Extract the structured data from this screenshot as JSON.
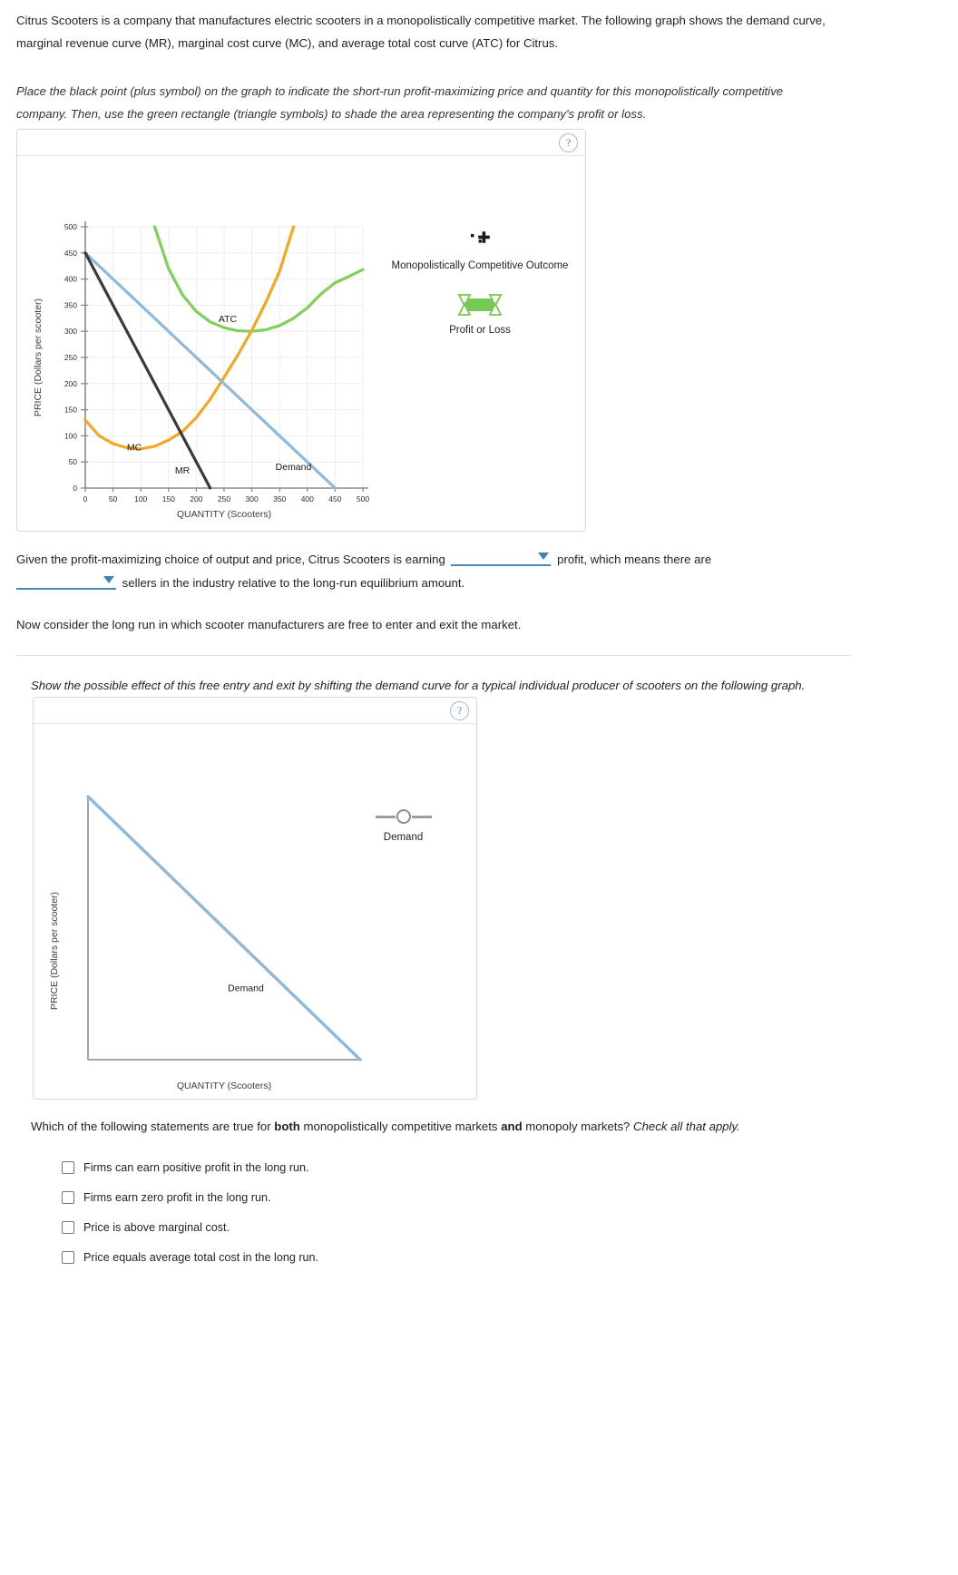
{
  "intro": {
    "paragraph": "Citrus Scooters is a company that manufactures electric scooters in a monopolistically competitive market. The following graph shows the demand curve, marginal revenue curve (MR), marginal cost curve (MC), and average total cost curve (ATC) for Citrus."
  },
  "instruction": {
    "text": "Place the black point (plus symbol) on the graph to indicate the short-run profit-maximizing price and quantity for this monopolistically competitive company. Then, use the green rectangle (triangle symbols) to shade the area representing the company's profit or loss."
  },
  "panel_one": {
    "help_label": "?",
    "tools": [
      {
        "label": "Monopolistically Competitive Outcome",
        "glyph": "black-plus-point"
      },
      {
        "label": "Profit or Loss",
        "glyph": "green-rectangle"
      }
    ]
  },
  "dropdown_sentence": {
    "part1": "Given the profit-maximizing choice of output and price, Citrus Scooters is earning",
    "part2": "profit, which means there are",
    "part3": "sellers in the industry relative to the long-run equilibrium amount.",
    "select1_value": "",
    "select2_value": ""
  },
  "long_run_text": "Now consider the long run in which scooter manufacturers are free to enter and exit the market.",
  "show_effect_text": "Show the possible effect of this free entry and exit by shifting the demand curve for a typical individual producer of scooters on the following graph.",
  "panel_two": {
    "help_label": "?",
    "tools": [
      {
        "label": "Demand",
        "glyph": "slider"
      }
    ]
  },
  "final_question": {
    "lead": "Which of the following statements are true for ",
    "bold1": "both",
    "mid": " monopolistically competitive markets ",
    "bold2": "and",
    "tail": " monopoly markets? ",
    "italic_tail": "Check all that apply."
  },
  "checkboxes": [
    {
      "label": "Firms can earn positive profit in the long run.",
      "checked": false
    },
    {
      "label": "Firms earn zero profit in the long run.",
      "checked": false
    },
    {
      "label": "Price is above marginal cost.",
      "checked": false
    },
    {
      "label": "Price equals average total cost in the long run.",
      "checked": false
    }
  ],
  "colors": {
    "demand": "#8fb8d9",
    "mr": "#3a3a3a",
    "mc": "#f5a623",
    "atc": "#7ed05a",
    "accent": "#3f82b4",
    "axis": "#8a8a8a",
    "grid": "#ededed"
  },
  "chart_data": [
    {
      "type": "line",
      "title": "Monopolistically competitive firm: Demand, MR, MC, ATC",
      "xlabel": "QUANTITY (Scooters)",
      "ylabel": "PRICE (Dollars per scooter)",
      "xlim": [
        0,
        500
      ],
      "ylim": [
        0,
        500
      ],
      "xticks": [
        0,
        50,
        100,
        150,
        200,
        250,
        300,
        350,
        400,
        450,
        500
      ],
      "yticks": [
        0,
        50,
        100,
        150,
        200,
        250,
        300,
        350,
        400,
        450,
        500
      ],
      "grid": true,
      "legend": "inline-labels",
      "series": [
        {
          "name": "Demand",
          "color": "#8fb8d9",
          "label_at": {
            "x": 375,
            "y": 35
          },
          "points": [
            [
              0,
              450
            ],
            [
              450,
              0
            ]
          ]
        },
        {
          "name": "MR",
          "color": "#3a3a3a",
          "label_at": {
            "x": 175,
            "y": 28
          },
          "points": [
            [
              0,
              450
            ],
            [
              225,
              0
            ]
          ]
        },
        {
          "name": "MC",
          "color": "#f5a623",
          "label_at": {
            "x": 75,
            "y": 72
          },
          "points": [
            [
              0,
              130
            ],
            [
              25,
              100
            ],
            [
              50,
              85
            ],
            [
              75,
              77
            ],
            [
              100,
              75
            ],
            [
              125,
              80
            ],
            [
              150,
              92
            ],
            [
              175,
              108
            ],
            [
              200,
              135
            ],
            [
              225,
              170
            ],
            [
              250,
              212
            ],
            [
              275,
              255
            ],
            [
              300,
              302
            ],
            [
              325,
              355
            ],
            [
              350,
              415
            ],
            [
              375,
              500
            ]
          ]
        },
        {
          "name": "ATC",
          "color": "#7ed05a",
          "label_at": {
            "x": 240,
            "y": 318
          },
          "points": [
            [
              125,
              500
            ],
            [
              150,
              420
            ],
            [
              175,
              370
            ],
            [
              200,
              338
            ],
            [
              225,
              318
            ],
            [
              250,
              307
            ],
            [
              275,
              301
            ],
            [
              300,
              300
            ],
            [
              325,
              303
            ],
            [
              350,
              311
            ],
            [
              375,
              325
            ],
            [
              400,
              345
            ],
            [
              425,
              372
            ],
            [
              450,
              393
            ],
            [
              475,
              405
            ],
            [
              500,
              418
            ]
          ]
        }
      ]
    },
    {
      "type": "line",
      "title": "Long-run demand shift for an individual producer",
      "xlabel": "QUANTITY (Scooters)",
      "ylabel": "PRICE (Dollars per scooter)",
      "xticks": [],
      "yticks": [],
      "grid": false,
      "series": [
        {
          "name": "Demand",
          "color": "#8fb8d9",
          "label_at": {
            "x": 0.58,
            "y": 0.26
          },
          "points": [
            [
              0.0,
              1.0
            ],
            [
              1.0,
              0.0
            ]
          ],
          "normalized": true
        }
      ]
    }
  ]
}
